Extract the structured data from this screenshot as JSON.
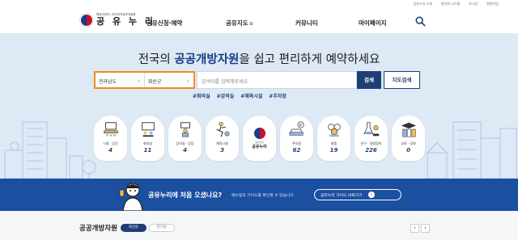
{
  "utility_links": [
    "공유누리 소개",
    "관리자 시스템",
    "로그인",
    "회원가입"
  ],
  "logo": {
    "sub": "행정안전부 | 한국지역정보개발원",
    "main": "공 유 누 리"
  },
  "nav": [
    {
      "label": "공유신청·예약"
    },
    {
      "label": "공유지도"
    },
    {
      "label": "커뮤니티"
    },
    {
      "label": "마이페이지"
    }
  ],
  "hero": {
    "headline_pre": "전국의 ",
    "headline_bold": "공공개방자원",
    "headline_post": "을 쉽고 편리하게 예약하세요"
  },
  "search": {
    "region": "전라남도",
    "district": "화순군",
    "keyword_placeholder": "검색어를 입력해주세요",
    "search_label": "검색",
    "map_label": "지도검색"
  },
  "tags": [
    "#회의실",
    "#강의실",
    "#체육시설",
    "#주차장"
  ],
  "categories": [
    {
      "label": "시설 · 공간",
      "count": "4",
      "icon": "meeting-room-icon"
    },
    {
      "label": "회의실",
      "count": "11",
      "icon": "lecture-room-icon"
    },
    {
      "label": "강의실 · 강당",
      "count": "4",
      "icon": "lecture-hall-icon"
    },
    {
      "label": "체육시설",
      "count": "3",
      "icon": "sports-icon"
    },
    {
      "label": "",
      "count": "",
      "icon": "center-logo"
    },
    {
      "label": "주차장",
      "count": "62",
      "icon": "parking-icon"
    },
    {
      "label": "물품",
      "count": "19",
      "icon": "goods-icon"
    },
    {
      "label": "연구 · 실험장비",
      "count": "226",
      "icon": "research-icon"
    },
    {
      "label": "교육 · 강좌",
      "count": "0",
      "icon": "education-icon"
    }
  ],
  "center": {
    "sub": "행정안전부",
    "title": "공유누리"
  },
  "banner": {
    "title": "공유누리에 처음 오셨나요?",
    "desc": "메뉴얼과 가이드를 확인할 수 있습니다.",
    "button": "공유누리 가이드 바로가기"
  },
  "section": {
    "title": "공공개방자원",
    "tab_latest": "최신순",
    "tab_popular": "인기순"
  },
  "colors": {
    "accent": "#1e3e78",
    "highlight": "#f08a24",
    "banner": "#1b4fa0",
    "hero_bg": "#dde9f5"
  }
}
